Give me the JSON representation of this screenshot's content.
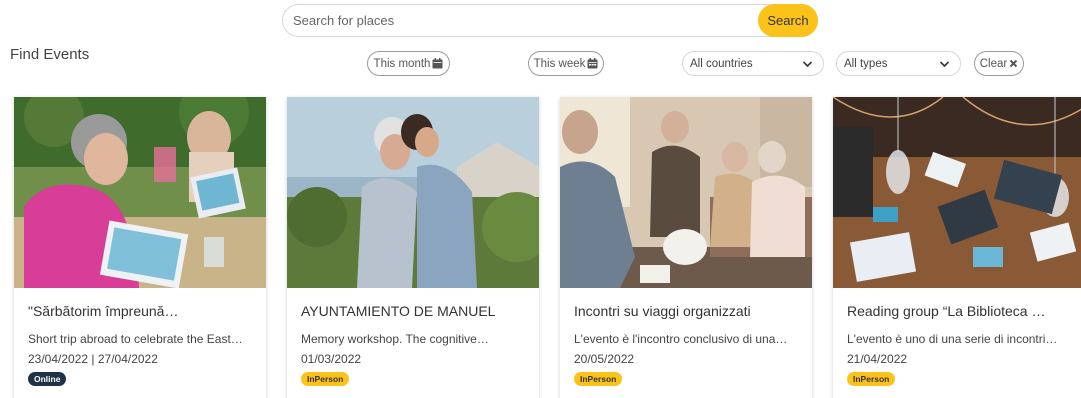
{
  "search": {
    "placeholder": "Search for places",
    "button_label": "Search"
  },
  "page_title": "Find Events",
  "filters": {
    "this_month": "This month",
    "this_week": "This week",
    "country": {
      "selected": "All countries"
    },
    "type": {
      "selected": "All types"
    },
    "clear": "Clear"
  },
  "icons": {
    "calendar": "calendar-icon",
    "chevron": "chevron-down-icon",
    "close": "close-icon"
  },
  "colors": {
    "accent": "#fbc21a",
    "online_badge": "#1f3347"
  },
  "events": [
    {
      "title": "\"Sărbătorim împreună…",
      "description": "Short trip abroad to celebrate the East…",
      "date": "23/04/2022 | 27/04/2022",
      "badge": "Online"
    },
    {
      "title": "AYUNTAMIENTO DE MANUEL",
      "description": "Memory workshop. The cognitive…",
      "date": "01/03/2022",
      "badge": "InPerson"
    },
    {
      "title": "Incontri su viaggi organizzati",
      "description": "L'evento è l'incontro conclusivo di una…",
      "date": "20/05/2022",
      "badge": "InPerson"
    },
    {
      "title": "Reading group “La Biblioteca …",
      "description": "L'evento è uno di una serie di incontri…",
      "date": "21/04/2022",
      "badge": "InPerson"
    }
  ]
}
